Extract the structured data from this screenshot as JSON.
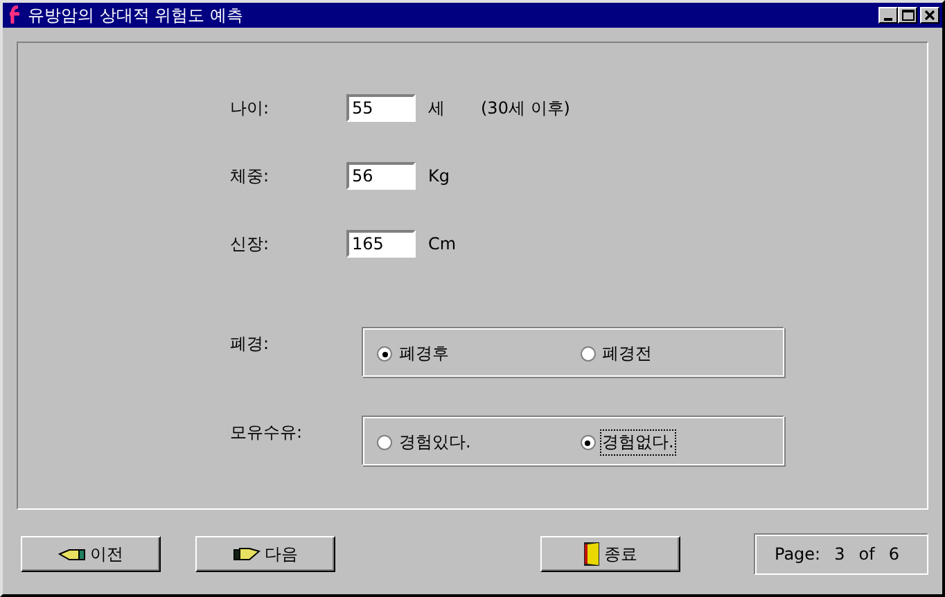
{
  "window": {
    "title": "유방암의 상대적 위험도 예측"
  },
  "fields": [
    {
      "label": "나이:",
      "value": "55",
      "unit": "세",
      "note": "(30세 이후)"
    },
    {
      "label": "체중:",
      "value": "56",
      "unit": "Kg"
    },
    {
      "label": "신장:",
      "value": "165",
      "unit": "Cm"
    }
  ],
  "radio_groups": [
    {
      "label": "폐경:",
      "options": [
        {
          "label": "폐경후",
          "selected": true,
          "focused": false
        },
        {
          "label": "폐경전",
          "selected": false,
          "focused": false
        }
      ]
    },
    {
      "label": "모유수유:",
      "options": [
        {
          "label": "경험있다.",
          "selected": false,
          "focused": false
        },
        {
          "label": "경험없다.",
          "selected": true,
          "focused": true
        }
      ]
    }
  ],
  "buttons": [
    {
      "label": "이전",
      "kind": "back"
    },
    {
      "label": "다음",
      "kind": "forward"
    },
    {
      "label": "종료",
      "kind": "exit"
    }
  ],
  "pager": {
    "label": "Page:",
    "current": "3",
    "of": "of",
    "total": "6"
  }
}
